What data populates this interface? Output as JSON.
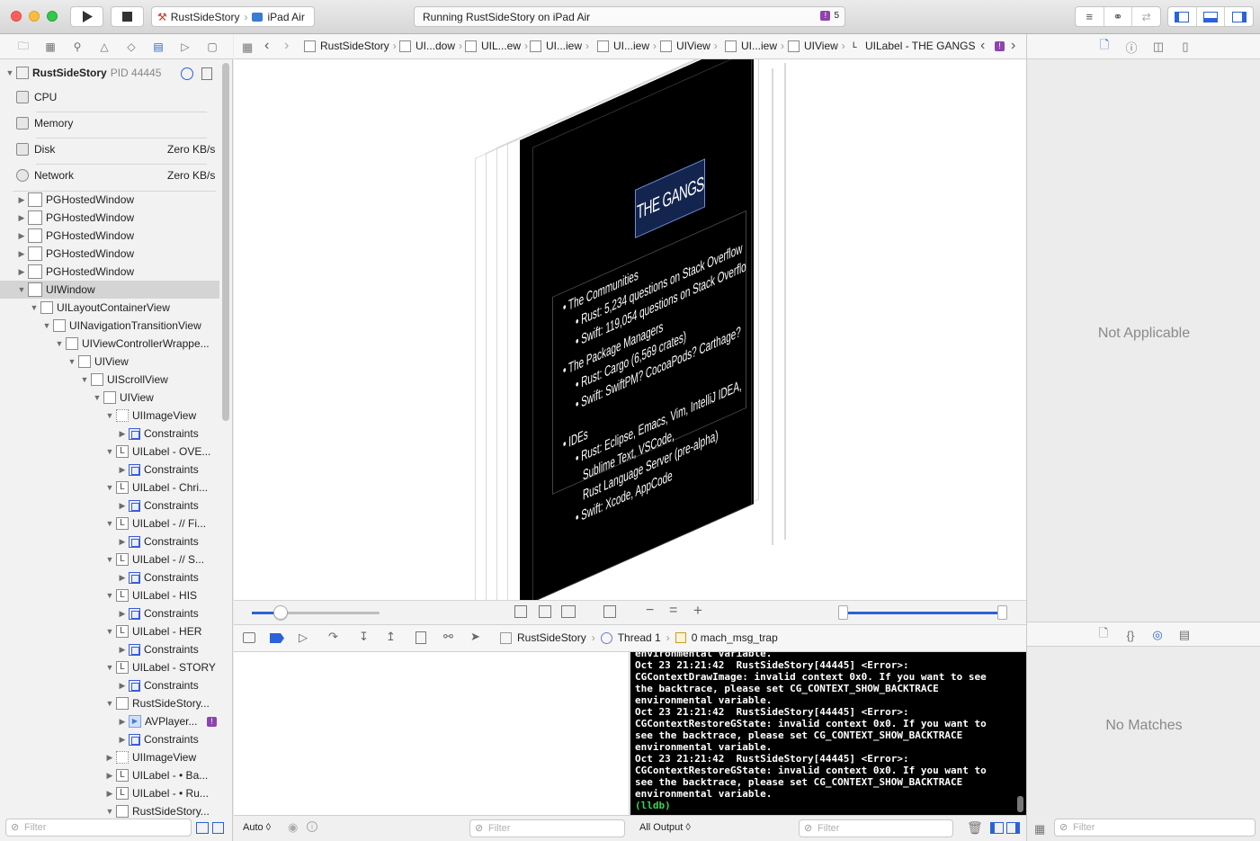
{
  "toolbar": {
    "scheme_name": "RustSideStory",
    "device_name": "iPad Air",
    "status_text": "Running RustSideStory on iPad Air",
    "issue_count": "5",
    "colors": {
      "close": "#fc605c",
      "minimize": "#fdbc40",
      "zoom": "#34c84a",
      "issue_badge": "#8e44ad",
      "accent": "#2a62d9"
    }
  },
  "navigator": {
    "process": {
      "name": "RustSideStory",
      "pid": "PID 44445"
    },
    "gauges": [
      {
        "label": "CPU",
        "value": ""
      },
      {
        "label": "Memory",
        "value": ""
      },
      {
        "label": "Disk",
        "value": "Zero KB/s"
      },
      {
        "label": "Network",
        "value": "Zero KB/s"
      }
    ],
    "tree": [
      {
        "label": "PGHostedWindow"
      },
      {
        "label": "PGHostedWindow"
      },
      {
        "label": "PGHostedWindow"
      },
      {
        "label": "PGHostedWindow"
      },
      {
        "label": "PGHostedWindow"
      },
      {
        "label": "UIWindow"
      },
      {
        "label": "UILayoutContainerView"
      },
      {
        "label": "UINavigationTransitionView"
      },
      {
        "label": "UIViewControllerWrappe..."
      },
      {
        "label": "UIView"
      },
      {
        "label": "UIScrollView"
      },
      {
        "label": "UIView"
      },
      {
        "label": "UIImageView"
      },
      {
        "label": "Constraints"
      },
      {
        "label": "UILabel - OVE..."
      },
      {
        "label": "Constraints"
      },
      {
        "label": "UILabel - Chri..."
      },
      {
        "label": "Constraints"
      },
      {
        "label": "UILabel - // Fi..."
      },
      {
        "label": "Constraints"
      },
      {
        "label": "UILabel - // S..."
      },
      {
        "label": "Constraints"
      },
      {
        "label": "UILabel - HIS"
      },
      {
        "label": "Constraints"
      },
      {
        "label": "UILabel - HER"
      },
      {
        "label": "Constraints"
      },
      {
        "label": "UILabel - STORY"
      },
      {
        "label": "Constraints"
      },
      {
        "label": "RustSideStory..."
      },
      {
        "label": "AVPlayer..."
      },
      {
        "label": "Constraints"
      },
      {
        "label": "UIImageView"
      },
      {
        "label": "UILabel - • Ba..."
      },
      {
        "label": "UILabel - • Ru..."
      },
      {
        "label": "RustSideStory..."
      }
    ],
    "filter_placeholder": "Filter"
  },
  "jumpbar": {
    "crumbs": [
      "RustSideStory",
      "UI...dow",
      "UIL...ew",
      "UI...iew",
      "UI...iew",
      "UIView",
      "UI...iew",
      "UIView",
      "UILabel - THE GANGS"
    ]
  },
  "slide": {
    "title": "THE GANGS",
    "lines": [
      "• The Communities",
      "• Rust: 5,234 questions on Stack Overflow",
      "• Swift: 119,054 questions on Stack Overflo",
      "• The Package Managers",
      "• Rust: Cargo (6,569 crates)",
      "• Swift: SwiftPM? CocoaPods? Carthage?",
      "• IDEs",
      "• Rust: Eclipse, Emacs, Vim, IntelliJ IDEA,",
      "Sublime Text, VSCode,",
      "Rust Language Server (pre-alpha)",
      "• Swift: Xcode, AppCode"
    ]
  },
  "debugbar": {
    "process": "RustSideStory",
    "thread": "Thread 1",
    "frame": "0 mach_msg_trap"
  },
  "console": {
    "lines": [
      "environmental variable.",
      "Oct 23 21:21:42  RustSideStory[44445] <Error>:",
      "CGContextDrawImage: invalid context 0x0. If you want to see",
      "the backtrace, please set CG_CONTEXT_SHOW_BACKTRACE",
      "environmental variable.",
      "Oct 23 21:21:42  RustSideStory[44445] <Error>:",
      "CGContextRestoreGState: invalid context 0x0. If you want to",
      "see the backtrace, please set CG_CONTEXT_SHOW_BACKTRACE",
      "environmental variable.",
      "Oct 23 21:21:42  RustSideStory[44445] <Error>:",
      "CGContextRestoreGState: invalid context 0x0. If you want to",
      "see the backtrace, please set CG_CONTEXT_SHOW_BACKTRACE",
      "environmental variable."
    ],
    "prompt": "(lldb)"
  },
  "bottombar": {
    "auto_label": "Auto ◊",
    "output_label": "All Output ◊",
    "filter_placeholder": "Filter"
  },
  "inspector": {
    "not_applicable": "Not Applicable",
    "no_matches": "No Matches",
    "filter_placeholder": "Filter"
  }
}
